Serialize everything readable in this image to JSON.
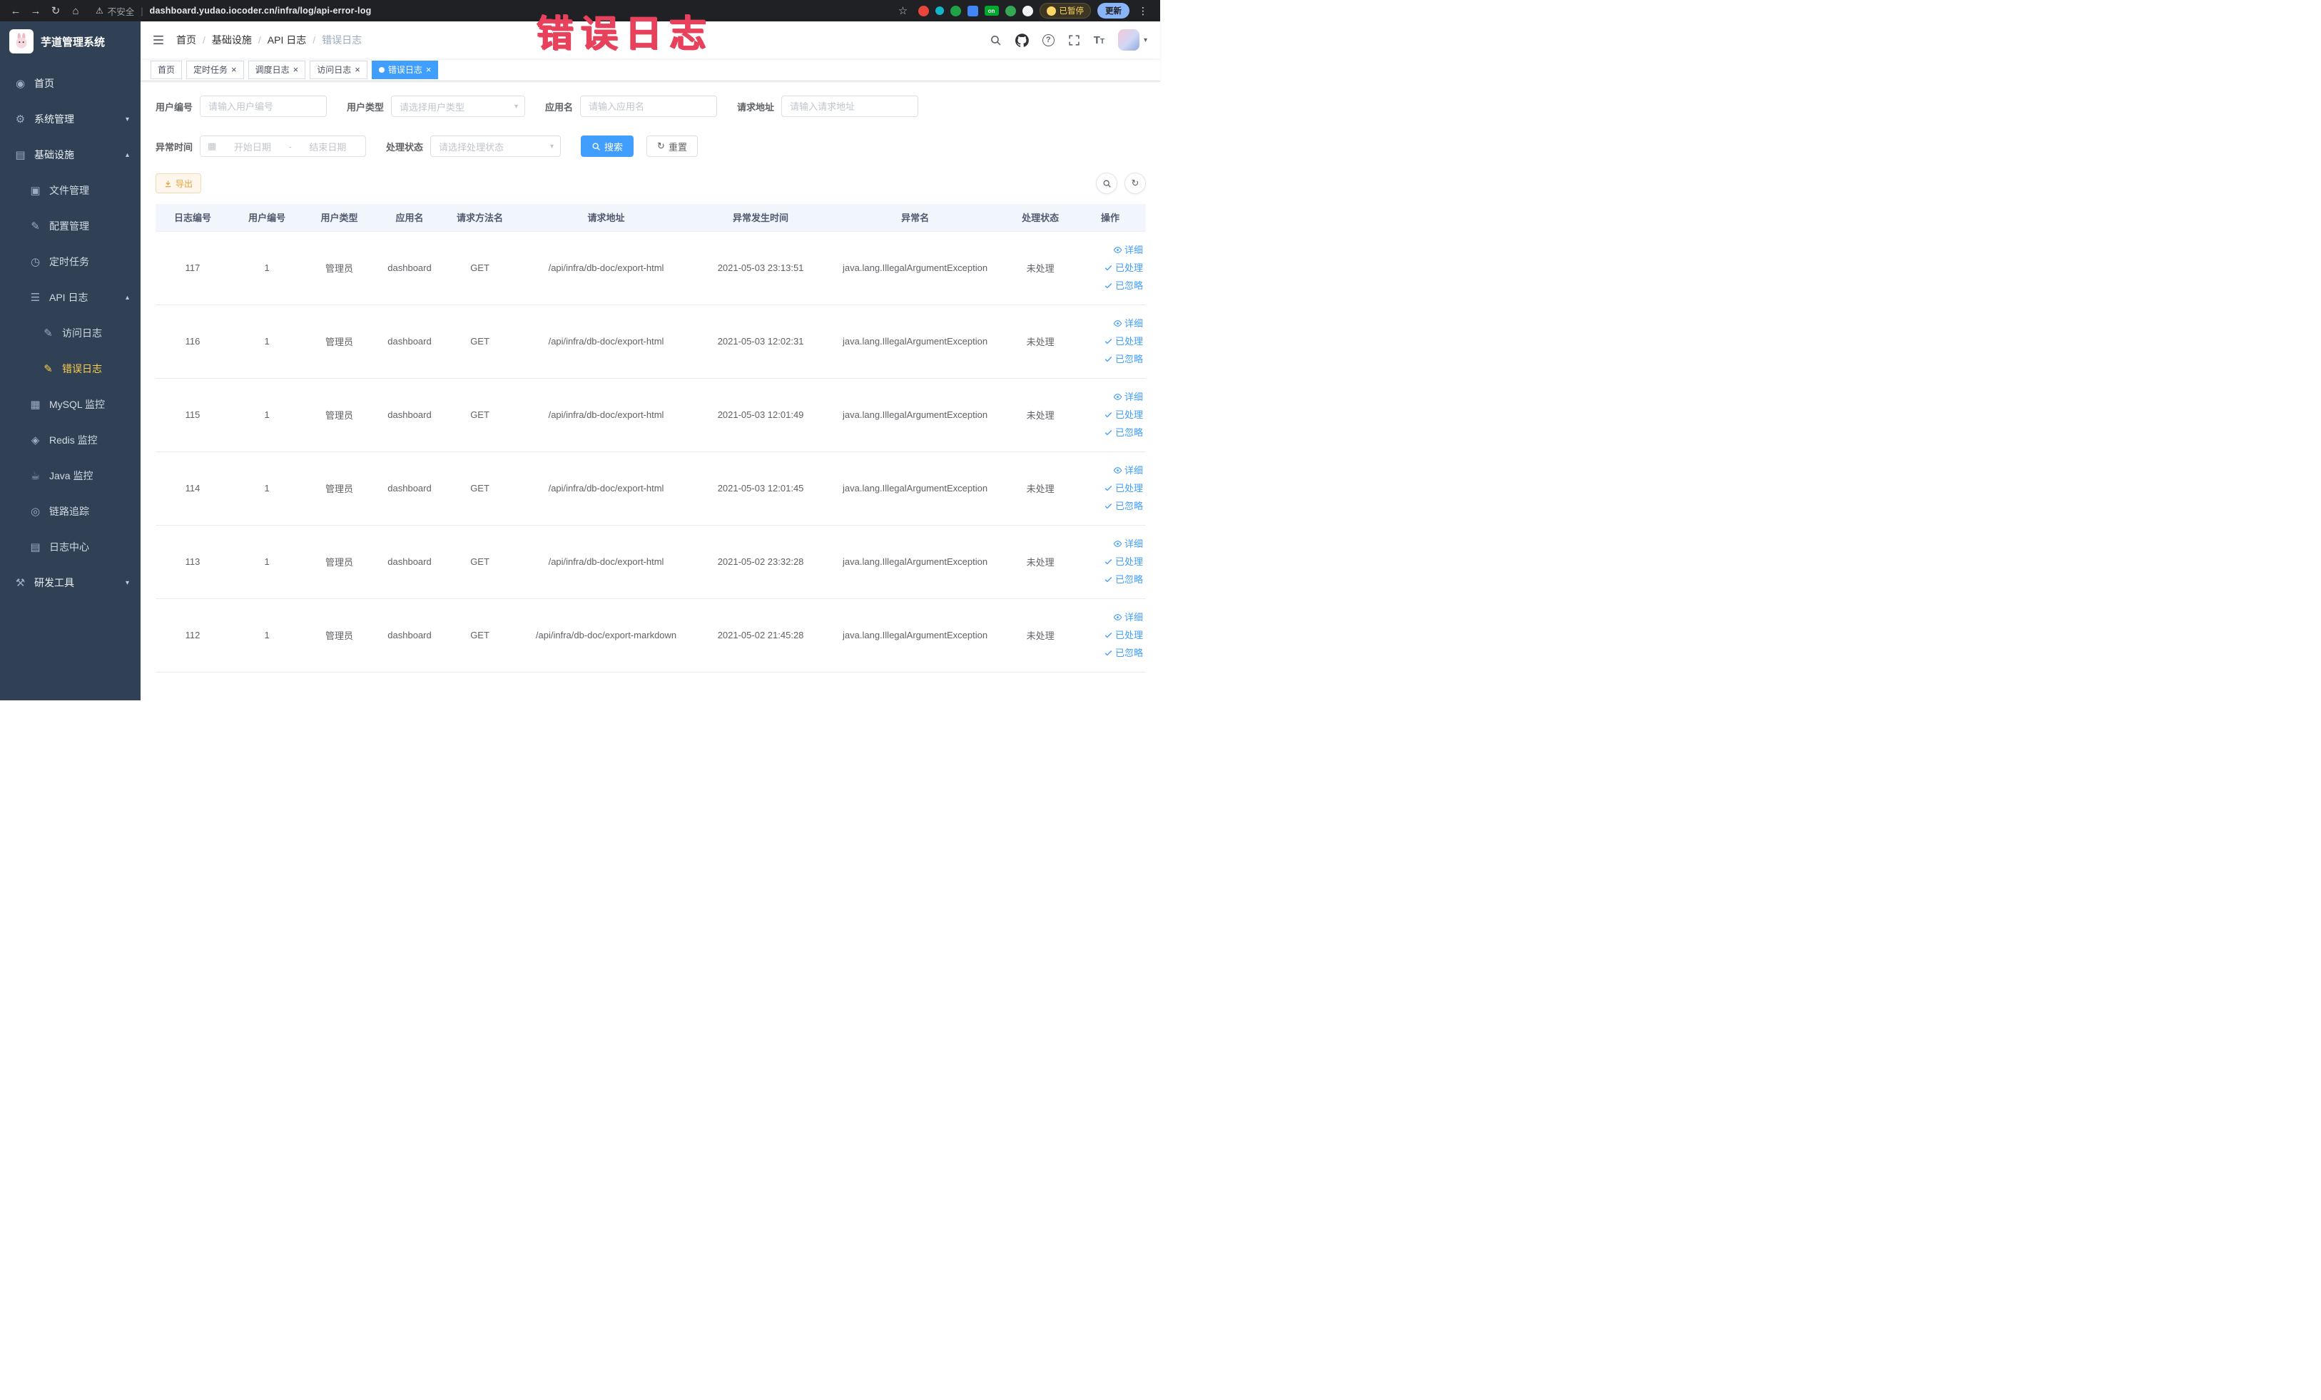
{
  "browser": {
    "security_label": "不安全",
    "url": "dashboard.yudao.iocoder.cn/infra/log/api-error-log",
    "paused_badge": "已暂停",
    "update_button": "更新",
    "extension_badge_on": "on"
  },
  "watermark": "错误日志",
  "sidebar": {
    "logo_title": "芋道管理系统",
    "items": [
      {
        "label": "首页"
      },
      {
        "label": "系统管理"
      },
      {
        "label": "基础设施"
      },
      {
        "label": "文件管理"
      },
      {
        "label": "配置管理"
      },
      {
        "label": "定时任务"
      },
      {
        "label": "API 日志"
      },
      {
        "label": "访问日志"
      },
      {
        "label": "错误日志"
      },
      {
        "label": "MySQL 监控"
      },
      {
        "label": "Redis 监控"
      },
      {
        "label": "Java 监控"
      },
      {
        "label": "链路追踪"
      },
      {
        "label": "日志中心"
      },
      {
        "label": "研发工具"
      }
    ]
  },
  "breadcrumb": {
    "separator": "/",
    "items": [
      "首页",
      "基础设施",
      "API 日志",
      "错误日志"
    ]
  },
  "tabs": [
    {
      "label": "首页"
    },
    {
      "label": "定时任务"
    },
    {
      "label": "调度日志"
    },
    {
      "label": "访问日志"
    },
    {
      "label": "错误日志"
    }
  ],
  "filters": {
    "user_id_label": "用户编号",
    "user_id_placeholder": "请输入用户编号",
    "user_type_label": "用户类型",
    "user_type_placeholder": "请选择用户类型",
    "app_name_label": "应用名",
    "app_name_placeholder": "请输入应用名",
    "request_url_label": "请求地址",
    "request_url_placeholder": "请输入请求地址",
    "exception_time_label": "异常时间",
    "date_start_placeholder": "开始日期",
    "date_separator": "-",
    "date_end_placeholder": "结束日期",
    "process_status_label": "处理状态",
    "process_status_placeholder": "请选择处理状态",
    "search_button": "搜索",
    "reset_button": "重置"
  },
  "toolbar": {
    "export_button": "导出"
  },
  "table": {
    "headers": [
      "日志编号",
      "用户编号",
      "用户类型",
      "应用名",
      "请求方法名",
      "请求地址",
      "异常发生时间",
      "异常名",
      "处理状态",
      "操作"
    ],
    "actions": {
      "detail": "详细",
      "processed": "已处理",
      "ignored": "已忽略"
    },
    "rows": [
      {
        "id": "117",
        "user_id": "1",
        "user_type": "管理员",
        "app": "dashboard",
        "method": "GET",
        "url": "/api/infra/db-doc/export-html",
        "time": "2021-05-03 23:13:51",
        "exception": "java.lang.IllegalArgumentException",
        "status": "未处理"
      },
      {
        "id": "116",
        "user_id": "1",
        "user_type": "管理员",
        "app": "dashboard",
        "method": "GET",
        "url": "/api/infra/db-doc/export-html",
        "time": "2021-05-03 12:02:31",
        "exception": "java.lang.IllegalArgumentException",
        "status": "未处理"
      },
      {
        "id": "115",
        "user_id": "1",
        "user_type": "管理员",
        "app": "dashboard",
        "method": "GET",
        "url": "/api/infra/db-doc/export-html",
        "time": "2021-05-03 12:01:49",
        "exception": "java.lang.IllegalArgumentException",
        "status": "未处理"
      },
      {
        "id": "114",
        "user_id": "1",
        "user_type": "管理员",
        "app": "dashboard",
        "method": "GET",
        "url": "/api/infra/db-doc/export-html",
        "time": "2021-05-03 12:01:45",
        "exception": "java.lang.IllegalArgumentException",
        "status": "未处理"
      },
      {
        "id": "113",
        "user_id": "1",
        "user_type": "管理员",
        "app": "dashboard",
        "method": "GET",
        "url": "/api/infra/db-doc/export-html",
        "time": "2021-05-02 23:32:28",
        "exception": "java.lang.IllegalArgumentException",
        "status": "未处理"
      },
      {
        "id": "112",
        "user_id": "1",
        "user_type": "管理员",
        "app": "dashboard",
        "method": "GET",
        "url": "/api/infra/db-doc/export-markdown",
        "time": "2021-05-02 21:45:28",
        "exception": "java.lang.IllegalArgumentException",
        "status": "未处理"
      }
    ]
  },
  "icons": {
    "back": "←",
    "forward": "→",
    "reload": "↻",
    "home": "⌂",
    "warning": "⚠",
    "star": "☆",
    "dots": "⋮",
    "pipe": "|",
    "help": "?",
    "close": "×",
    "caret_down": "▾",
    "caret_up": "▴",
    "calendar": "▦",
    "font_size": "T",
    "menu_home": "◉",
    "menu_system": "⚙",
    "menu_infra": "▤",
    "menu_file": "▣",
    "menu_config": "✎",
    "menu_job": "◷",
    "menu_apilog": "☰",
    "menu_accesslog": "✎",
    "menu_errorlog": "✎",
    "menu_mysql": "▦",
    "menu_redis": "◈",
    "menu_java": "☕",
    "menu_trace": "◎",
    "menu_logcenter": "▤",
    "menu_devtools": "⚒"
  },
  "colors": {
    "accent": "#409EFF",
    "active_menu_text": "#FFD04B",
    "warning": "#E6A23C",
    "watermark": "#E8415C",
    "sidebar_bg": "#304156",
    "table_header_bg": "#F1F6FC"
  }
}
